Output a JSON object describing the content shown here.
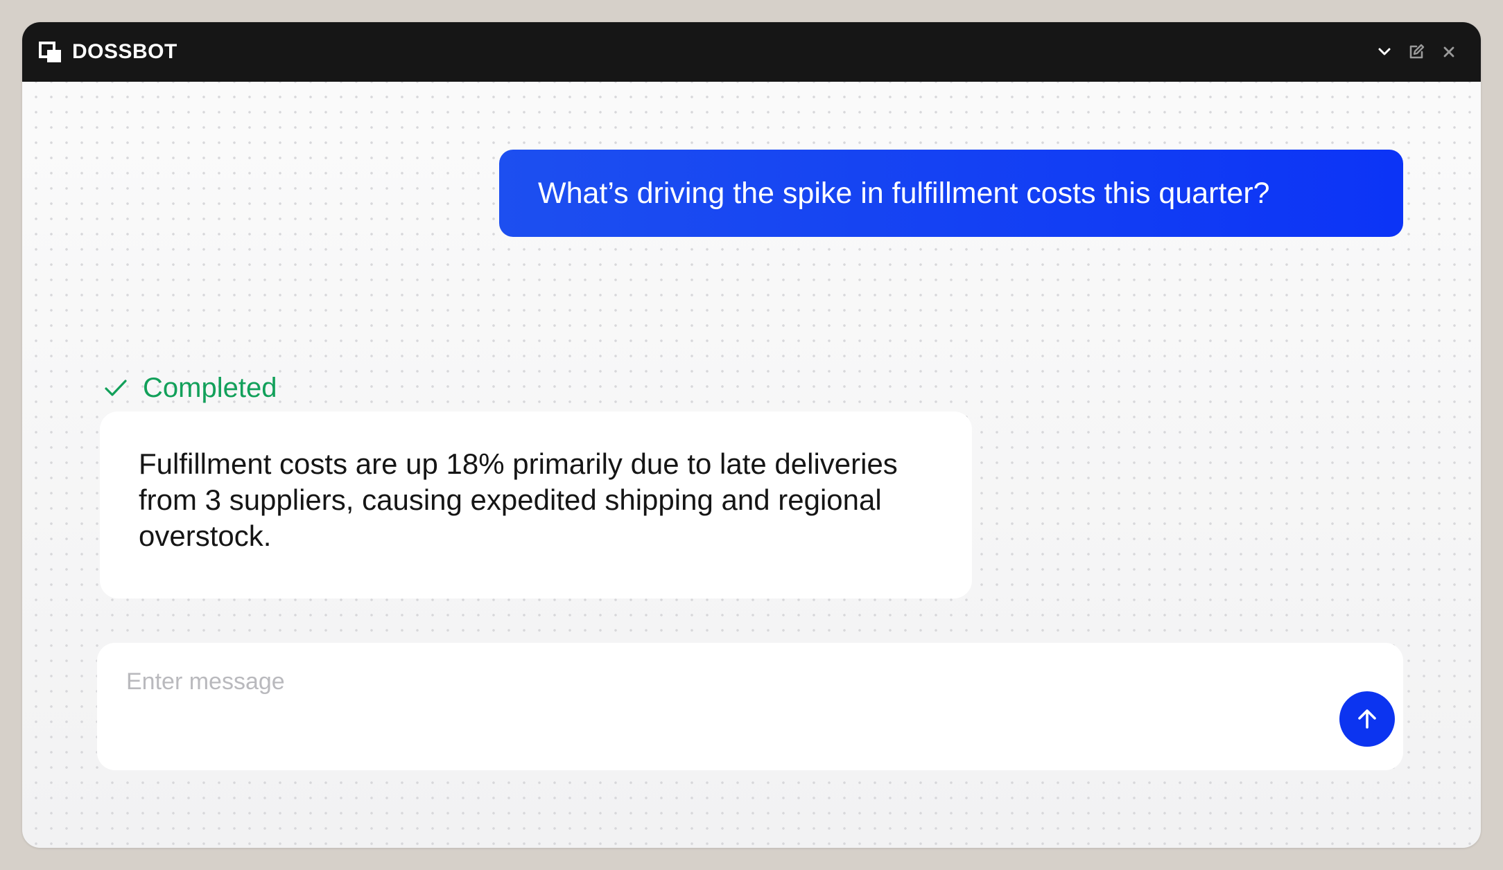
{
  "window": {
    "title": "DOSSBOT",
    "icons": [
      "dossbot-logo-icon",
      "chevron-down-icon",
      "edit-icon",
      "close-icon"
    ]
  },
  "conversation": {
    "user_message": "What’s driving the spike in fulfillment costs this quarter?",
    "status": "Completed",
    "bot_response": "Fulfillment costs are up 18% primarily due to late deliveries from 3 suppliers, causing expedited shipping and regional overstock."
  },
  "composer": {
    "placeholder": "Enter message",
    "value": "",
    "send_icon": "arrow-up-icon"
  },
  "colors": {
    "titlebar": "#161616",
    "user_bubble": "#1d4ff0",
    "status_green": "#12a05a",
    "send_button": "#0c34f0"
  }
}
